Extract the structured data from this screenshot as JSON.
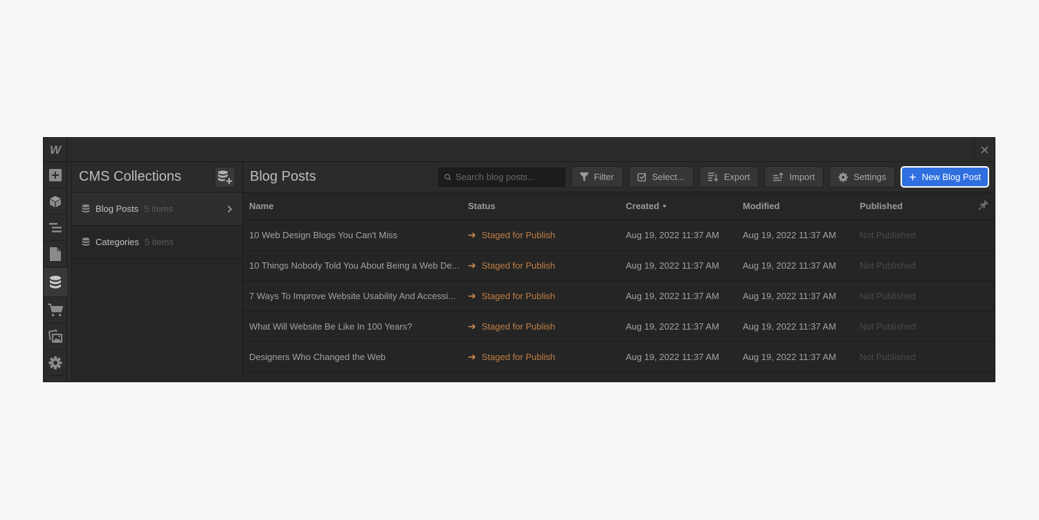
{
  "app": {
    "logo": "W"
  },
  "leftbar": {
    "items": [
      {
        "name": "add-panel",
        "icon": "plus-square-icon"
      },
      {
        "name": "components",
        "icon": "cube-icon"
      },
      {
        "name": "navigator",
        "icon": "layers-icon"
      },
      {
        "name": "pages",
        "icon": "page-icon"
      },
      {
        "name": "cms",
        "icon": "database-icon",
        "active": true
      },
      {
        "name": "ecommerce",
        "icon": "cart-icon"
      },
      {
        "name": "assets",
        "icon": "images-icon"
      },
      {
        "name": "settings",
        "icon": "gear-icon"
      }
    ]
  },
  "collections": {
    "title": "CMS Collections",
    "add_button_icon": "add-collection-icon",
    "items": [
      {
        "name": "Blog Posts",
        "count": "5 items",
        "active": true
      },
      {
        "name": "Categories",
        "count": "5 items",
        "active": false
      }
    ]
  },
  "main": {
    "title": "Blog Posts",
    "search_placeholder": "Search blog posts...",
    "toolbar": {
      "filter": "Filter",
      "select": "Select...",
      "export": "Export",
      "import": "Import",
      "settings": "Settings",
      "new_item": "New Blog Post"
    },
    "columns": [
      "Name",
      "Status",
      "Created",
      "Modified",
      "Published"
    ],
    "sorted_column": "Created",
    "rows": [
      {
        "name": "10 Web Design Blogs You Can't Miss",
        "status": "Staged for Publish",
        "created": "Aug 19, 2022 11:37 AM",
        "modified": "Aug 19, 2022 11:37 AM",
        "published": "Not Published"
      },
      {
        "name": "10 Things Nobody Told You About Being a Web De...",
        "status": "Staged for Publish",
        "created": "Aug 19, 2022 11:37 AM",
        "modified": "Aug 19, 2022 11:37 AM",
        "published": "Not Published"
      },
      {
        "name": "7 Ways To Improve Website Usability And Accessi...",
        "status": "Staged for Publish",
        "created": "Aug 19, 2022 11:37 AM",
        "modified": "Aug 19, 2022 11:37 AM",
        "published": "Not Published"
      },
      {
        "name": "What Will Website Be Like In 100 Years?",
        "status": "Staged for Publish",
        "created": "Aug 19, 2022 11:37 AM",
        "modified": "Aug 19, 2022 11:37 AM",
        "published": "Not Published"
      },
      {
        "name": "Designers Who Changed the Web",
        "status": "Staged for Publish",
        "created": "Aug 19, 2022 11:37 AM",
        "modified": "Aug 19, 2022 11:37 AM",
        "published": "Not Published"
      }
    ]
  },
  "colors": {
    "accent": "#2f6fdf",
    "status_staged": "#c17f45",
    "background": "#252525"
  }
}
